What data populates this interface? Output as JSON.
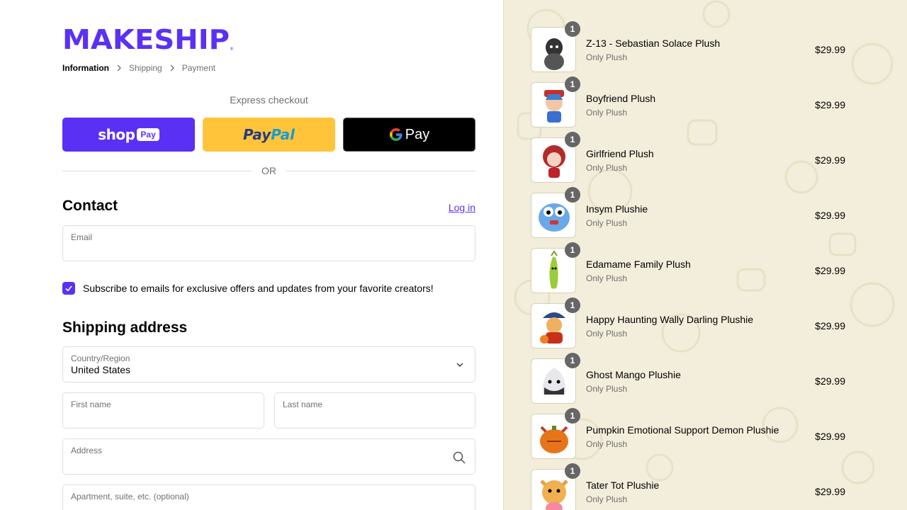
{
  "brand": {
    "logo_text": "MAKESHIP",
    "accent": "#5a31f4"
  },
  "breadcrumb": [
    {
      "label": "Information",
      "active": true
    },
    {
      "label": "Shipping",
      "active": false
    },
    {
      "label": "Payment",
      "active": false
    }
  ],
  "express": {
    "label": "Express checkout",
    "shop_pay": {
      "text": "shop",
      "badge": "Pay",
      "color": "#5a31f4"
    },
    "paypal": {
      "text_a": "Pay",
      "text_b": "Pal",
      "color": "#ffc439"
    },
    "gpay": {
      "text": "Pay",
      "color": "#000000"
    }
  },
  "divider": {
    "text": "OR"
  },
  "contact": {
    "title": "Contact",
    "login_link": "Log in",
    "email_label": "Email",
    "email_value": "",
    "subscribe_checked": true,
    "subscribe_label": "Subscribe to emails for exclusive offers and updates from your favorite creators!"
  },
  "shipping": {
    "title": "Shipping address",
    "country_label": "Country/Region",
    "country_value": "United States",
    "first_name_label": "First name",
    "last_name_label": "Last name",
    "address_label": "Address",
    "apartment_label": "Apartment, suite, etc. (optional)"
  },
  "order": {
    "items": [
      {
        "name": "Z-13 - Sebastian Solace Plush",
        "variant": "Only Plush",
        "price": "$29.99",
        "qty": "1"
      },
      {
        "name": "Boyfriend Plush",
        "variant": "Only Plush",
        "price": "$29.99",
        "qty": "1"
      },
      {
        "name": "Girlfriend Plush",
        "variant": "Only Plush",
        "price": "$29.99",
        "qty": "1"
      },
      {
        "name": "Insym Plushie",
        "variant": "Only Plush",
        "price": "$29.99",
        "qty": "1"
      },
      {
        "name": "Edamame Family Plush",
        "variant": "Only Plush",
        "price": "$29.99",
        "qty": "1"
      },
      {
        "name": "Happy Haunting Wally Darling Plushie",
        "variant": "Only Plush",
        "price": "$29.99",
        "qty": "1"
      },
      {
        "name": "Ghost Mango Plushie",
        "variant": "Only Plush",
        "price": "$29.99",
        "qty": "1"
      },
      {
        "name": "Pumpkin Emotional Support Demon Plushie",
        "variant": "Only Plush",
        "price": "$29.99",
        "qty": "1"
      },
      {
        "name": "Tater Tot Plushie",
        "variant": "Only Plush",
        "price": "$29.99",
        "qty": "1"
      }
    ]
  }
}
